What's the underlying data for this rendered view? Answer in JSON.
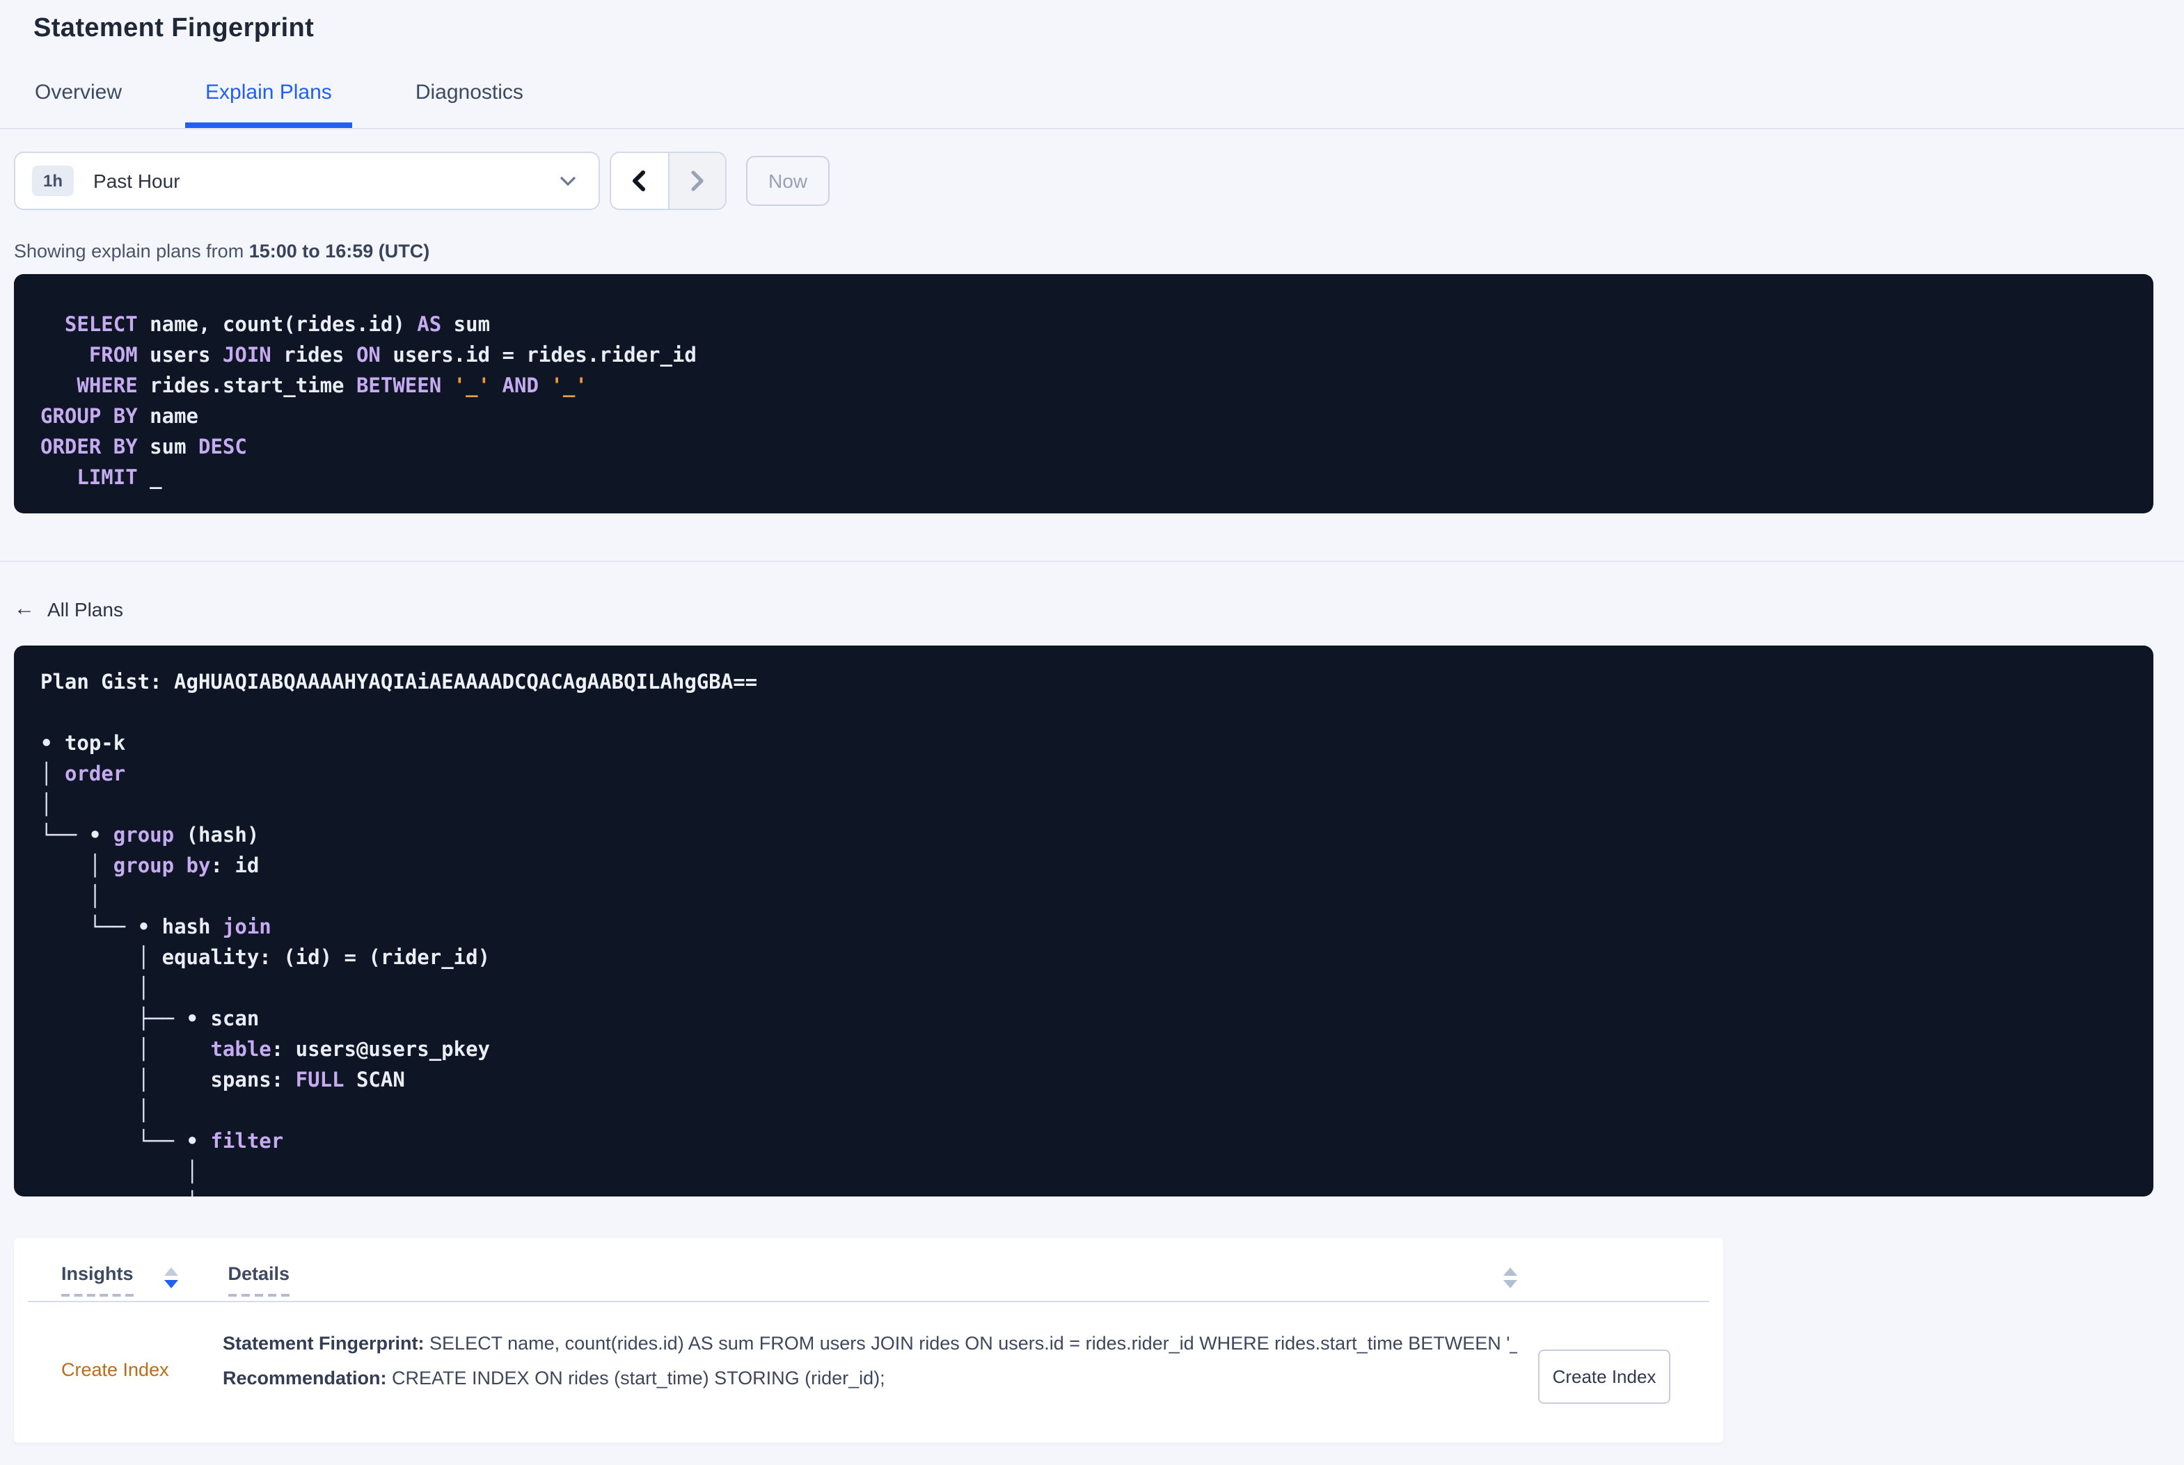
{
  "colors": {
    "accent_blue": "#2160f0",
    "code_bg": "#0e1626",
    "keyword_purple": "#c7abf1",
    "literal_orange": "#ec9a3c",
    "insight_orange": "#bf6b14"
  },
  "page": {
    "title": "Statement Fingerprint"
  },
  "tabs": [
    {
      "label": "Overview",
      "active": false
    },
    {
      "label": "Explain Plans",
      "active": true
    },
    {
      "label": "Diagnostics",
      "active": false
    }
  ],
  "time_picker": {
    "badge": "1h",
    "label": "Past Hour",
    "now_label": "Now"
  },
  "icons": {
    "time_dropdown": "chevron-down",
    "prev_range": "chevron-left",
    "next_range": "chevron-right",
    "all_plans_back": "arrow-left",
    "sort_insights": "sort-arrows-desc",
    "sort_details": "sort-arrows"
  },
  "showing": {
    "prefix": "Showing explain plans from ",
    "range": "15:00 to 16:59 (UTC)"
  },
  "sql": {
    "lines": [
      [
        [
          "k",
          "  SELECT"
        ],
        [
          "w",
          " name, count(rides.id) "
        ],
        [
          "k",
          "AS"
        ],
        [
          "w",
          " sum"
        ]
      ],
      [
        [
          "k",
          "    FROM"
        ],
        [
          "w",
          " users "
        ],
        [
          "k",
          "JOIN"
        ],
        [
          "w",
          " rides "
        ],
        [
          "k",
          "ON"
        ],
        [
          "w",
          " users.id = rides.rider_id"
        ]
      ],
      [
        [
          "k",
          "   WHERE"
        ],
        [
          "w",
          " rides.start_time "
        ],
        [
          "k",
          "BETWEEN"
        ],
        [
          "w",
          " "
        ],
        [
          "l",
          "'_'"
        ],
        [
          "w",
          " "
        ],
        [
          "k",
          "AND"
        ],
        [
          "w",
          " "
        ],
        [
          "l",
          "'_'"
        ]
      ],
      [
        [
          "k",
          "GROUP BY"
        ],
        [
          "w",
          " name"
        ]
      ],
      [
        [
          "k",
          "ORDER BY"
        ],
        [
          "w",
          " sum "
        ],
        [
          "k",
          "DESC"
        ]
      ],
      [
        [
          "k",
          "   LIMIT"
        ],
        [
          "w",
          " _"
        ]
      ]
    ]
  },
  "all_plans_label": "All Plans",
  "plan": {
    "tree_lines": [
      [
        [
          "g",
          "Plan Gist: AgHUAQIABQAAAAHYAQIAiAEAAAADCQACAgAABQILAhgGBA=="
        ]
      ],
      [],
      [
        [
          "w",
          "• top-k"
        ]
      ],
      [
        [
          "c",
          "│ "
        ],
        [
          "k",
          "order"
        ]
      ],
      [
        [
          "c",
          "│"
        ]
      ],
      [
        [
          "c",
          "└── "
        ],
        [
          "w",
          "• "
        ],
        [
          "k",
          "group"
        ],
        [
          "w",
          " (hash)"
        ]
      ],
      [
        [
          "c",
          "    │ "
        ],
        [
          "k",
          "group by"
        ],
        [
          "w",
          ": id"
        ]
      ],
      [
        [
          "c",
          "    │"
        ]
      ],
      [
        [
          "c",
          "    └── "
        ],
        [
          "w",
          "• hash "
        ],
        [
          "k",
          "join"
        ]
      ],
      [
        [
          "c",
          "        │ "
        ],
        [
          "w",
          "equality: (id) = (rider_id)"
        ]
      ],
      [
        [
          "c",
          "        │"
        ]
      ],
      [
        [
          "c",
          "        ├── "
        ],
        [
          "w",
          "• scan"
        ]
      ],
      [
        [
          "c",
          "        │     "
        ],
        [
          "k",
          "table"
        ],
        [
          "w",
          ": users@users_pkey"
        ]
      ],
      [
        [
          "c",
          "        │     "
        ],
        [
          "w",
          "spans: "
        ],
        [
          "k",
          "FULL"
        ],
        [
          "w",
          " SCAN"
        ]
      ],
      [
        [
          "c",
          "        │"
        ]
      ],
      [
        [
          "c",
          "        └── "
        ],
        [
          "w",
          "• "
        ],
        [
          "k",
          "filter"
        ]
      ],
      [
        [
          "c",
          "            │"
        ]
      ],
      [
        [
          "c",
          "            │"
        ]
      ]
    ]
  },
  "insights_table": {
    "columns": [
      {
        "label": "Insights",
        "sorted": "desc"
      },
      {
        "label": "Details",
        "sorted": "none"
      }
    ],
    "rows": [
      {
        "insight": "Create Index",
        "fingerprint_label": "Statement Fingerprint:",
        "fingerprint_text": " SELECT name, count(rides.id) AS sum FROM users JOIN rides ON users.id = rides.rider_id WHERE rides.start_time BETWEEN '_…",
        "recommendation_label": "Recommendation:",
        "recommendation_text": " CREATE INDEX ON rides (start_time) STORING (rider_id);",
        "action_button": "Create Index"
      }
    ]
  }
}
